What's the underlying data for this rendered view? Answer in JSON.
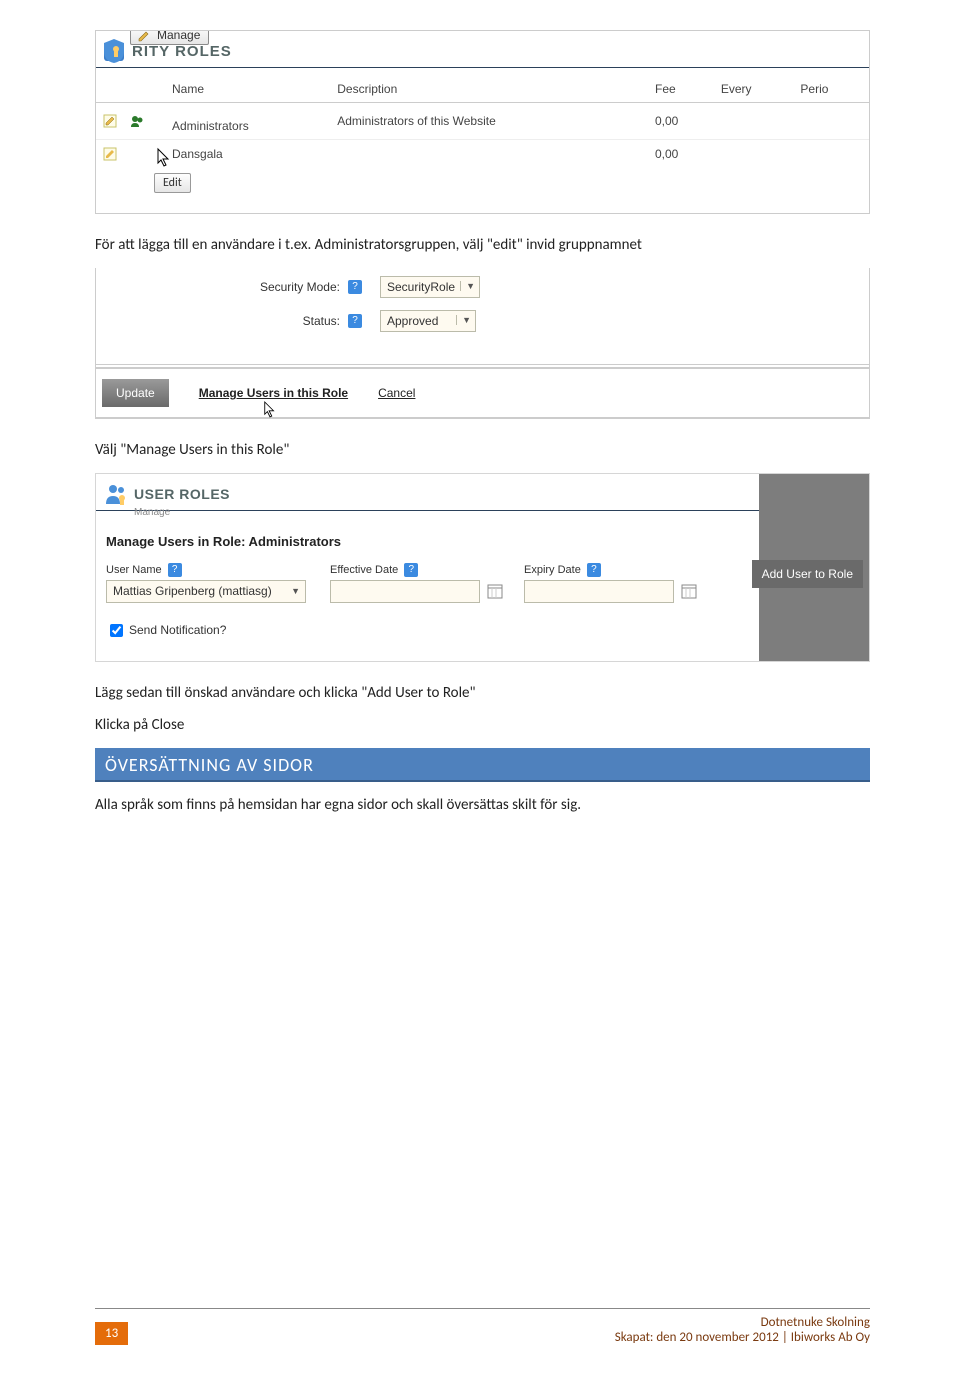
{
  "roles_screenshot": {
    "title_visible": "RITY ROLES",
    "manage_btn": "Manage",
    "columns": [
      "Name",
      "Description",
      "Fee",
      "Every",
      "Perio"
    ],
    "rows": [
      {
        "name": "Administrators",
        "description": "Administrators of this Website",
        "fee": "0,00"
      },
      {
        "name": "Dansgala",
        "description": "",
        "fee": "0,00"
      }
    ],
    "edit_tooltip": "Edit"
  },
  "para1": "För att lägga till en användare i t.ex. Administratorsgruppen, välj \"edit\" invid gruppnamnet",
  "form": {
    "security_mode_label": "Security Mode:",
    "security_mode_value": "SecurityRole",
    "status_label": "Status:",
    "status_value": "Approved",
    "update": "Update",
    "manage_users": "Manage Users in this Role",
    "cancel": "Cancel"
  },
  "para2": "Välj \"Manage Users in this Role\"",
  "user_roles": {
    "title": "USER ROLES",
    "sub": "Manage",
    "manage_heading": "Manage Users in Role: Administrators",
    "user_name_label": "User Name",
    "user_name_value": "Mattias Gripenberg (mattiasg)",
    "effective_label": "Effective Date",
    "expiry_label": "Expiry Date",
    "add_btn": "Add User to Role",
    "send_notification": "Send Notification?"
  },
  "para3": "Lägg sedan till önskad användare och klicka \"Add User to Role\"",
  "para4": "Klicka på Close",
  "heading": "ÖVERSÄTTNING AV SIDOR",
  "para5": "Alla språk som finns på hemsidan har egna sidor och skall översättas skilt för sig.",
  "footer": {
    "page": "13",
    "title": "Dotnetnuke Skolning",
    "created": "Skapat: den 20 november 2012 | Ibiworks Ab Oy"
  }
}
